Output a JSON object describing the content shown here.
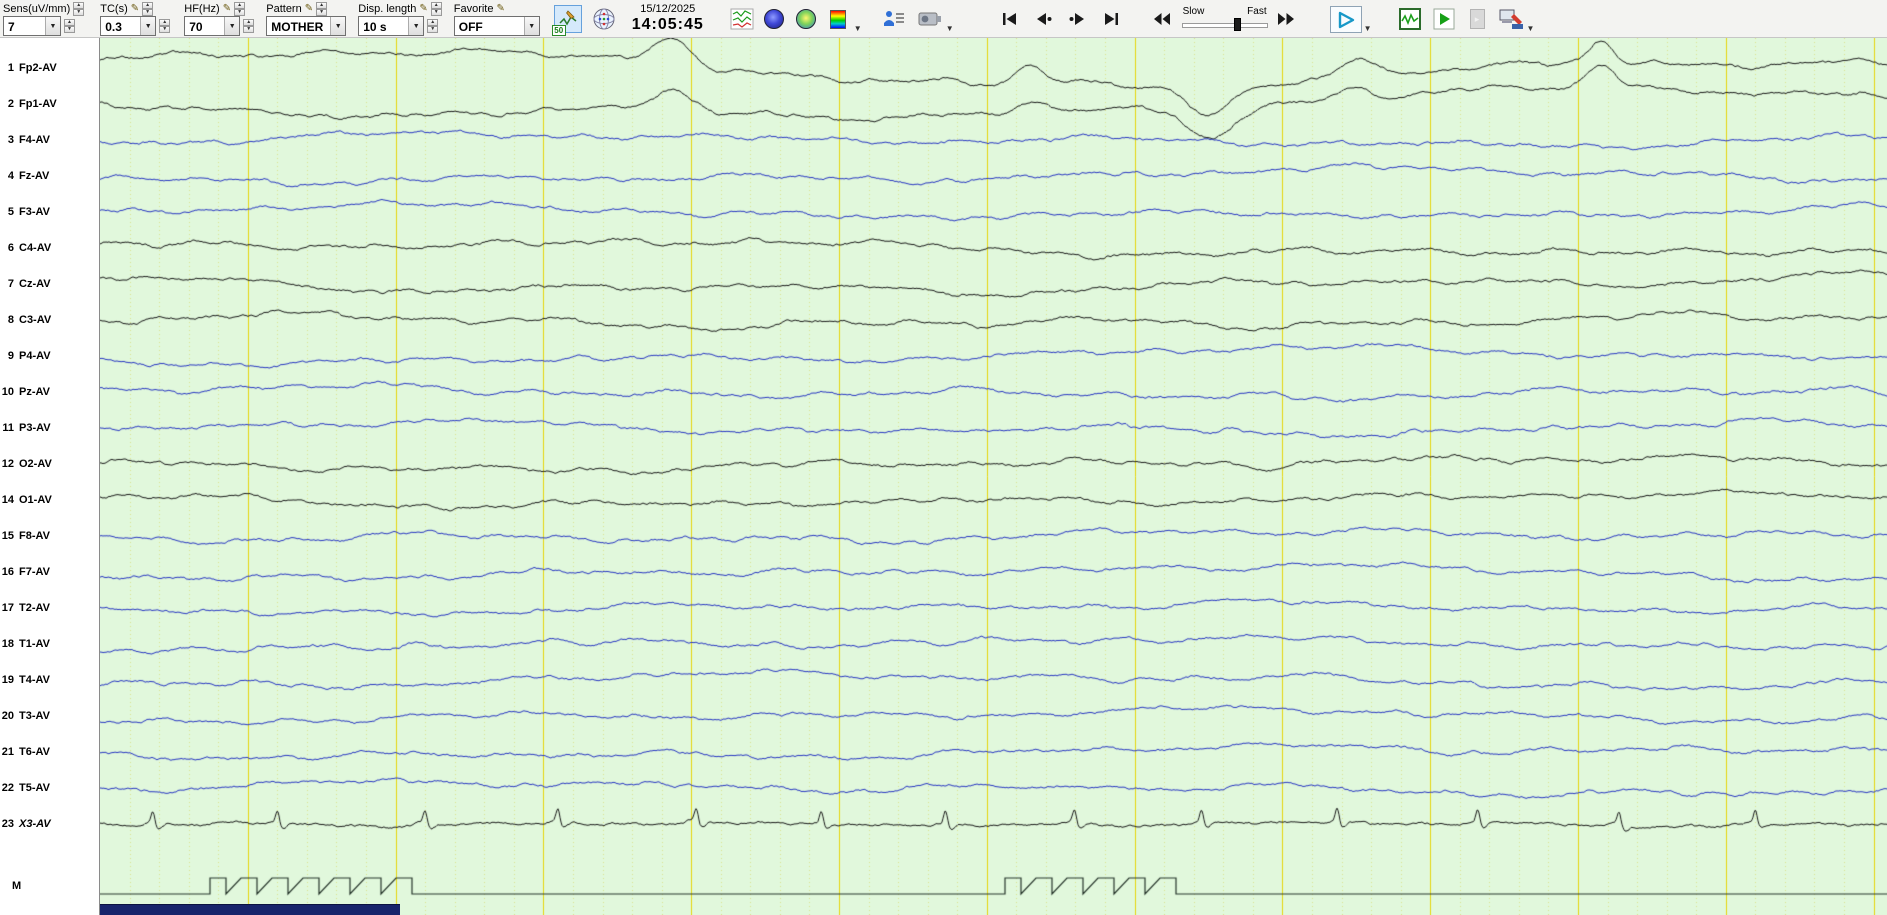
{
  "toolbar": {
    "controls": [
      {
        "label": "Sens(uV/mm)",
        "value": "7"
      },
      {
        "label": "TC(s)",
        "value": "0.3"
      },
      {
        "label": "HF(Hz)",
        "value": "70"
      },
      {
        "label": "Pattern",
        "value": "MOTHER"
      },
      {
        "label": "Disp. length",
        "value": "10 s"
      },
      {
        "label": "Favorite",
        "value": "OFF"
      }
    ],
    "ac_filter_label": "50",
    "datetime": {
      "date": "15/12/2025",
      "time": "14:05:45"
    },
    "speed_slider": {
      "slow_label": "Slow",
      "fast_label": "Fast",
      "position": 0.66
    }
  },
  "channels": [
    {
      "num": "1",
      "label": "Fp2-AV",
      "color": "black",
      "type": "frontal"
    },
    {
      "num": "2",
      "label": "Fp1-AV",
      "color": "black",
      "type": "frontal"
    },
    {
      "num": "3",
      "label": "F4-AV",
      "color": "blue",
      "type": "eeg"
    },
    {
      "num": "4",
      "label": "Fz-AV",
      "color": "blue",
      "type": "eeg"
    },
    {
      "num": "5",
      "label": "F3-AV",
      "color": "blue",
      "type": "eeg"
    },
    {
      "num": "6",
      "label": "C4-AV",
      "color": "black",
      "type": "eeg"
    },
    {
      "num": "7",
      "label": "Cz-AV",
      "color": "black",
      "type": "eeg"
    },
    {
      "num": "8",
      "label": "C3-AV",
      "color": "black",
      "type": "eeg"
    },
    {
      "num": "9",
      "label": "P4-AV",
      "color": "blue",
      "type": "eeg"
    },
    {
      "num": "10",
      "label": "Pz-AV",
      "color": "blue",
      "type": "eeg"
    },
    {
      "num": "11",
      "label": "P3-AV",
      "color": "blue",
      "type": "eeg"
    },
    {
      "num": "12",
      "label": "O2-AV",
      "color": "black",
      "type": "eeg"
    },
    {
      "num": "14",
      "label": "O1-AV",
      "color": "black",
      "type": "eeg"
    },
    {
      "num": "15",
      "label": "F8-AV",
      "color": "blue",
      "type": "eeg"
    },
    {
      "num": "16",
      "label": "F7-AV",
      "color": "blue",
      "type": "eeg"
    },
    {
      "num": "17",
      "label": "T2-AV",
      "color": "blue",
      "type": "eeg"
    },
    {
      "num": "18",
      "label": "T1-AV",
      "color": "blue",
      "type": "eeg"
    },
    {
      "num": "19",
      "label": "T4-AV",
      "color": "blue",
      "type": "eeg"
    },
    {
      "num": "20",
      "label": "T3-AV",
      "color": "blue",
      "type": "eeg"
    },
    {
      "num": "21",
      "label": "T6-AV",
      "color": "blue",
      "type": "eeg"
    },
    {
      "num": "22",
      "label": "T5-AV",
      "color": "blue",
      "type": "eeg"
    },
    {
      "num": "23",
      "label": "X3-AV",
      "color": "black",
      "type": "ecg",
      "italic": true
    }
  ],
  "marker": {
    "label": "M"
  },
  "colors": {
    "eeg_background": "#e1f8dc",
    "grid_major": "rgba(230,212,0,0.95)",
    "grid_minor": "rgba(212,198,40,0.45)",
    "trace_black": "#181818",
    "trace_blue": "#2534c2",
    "marker_trace": "#25342a"
  }
}
